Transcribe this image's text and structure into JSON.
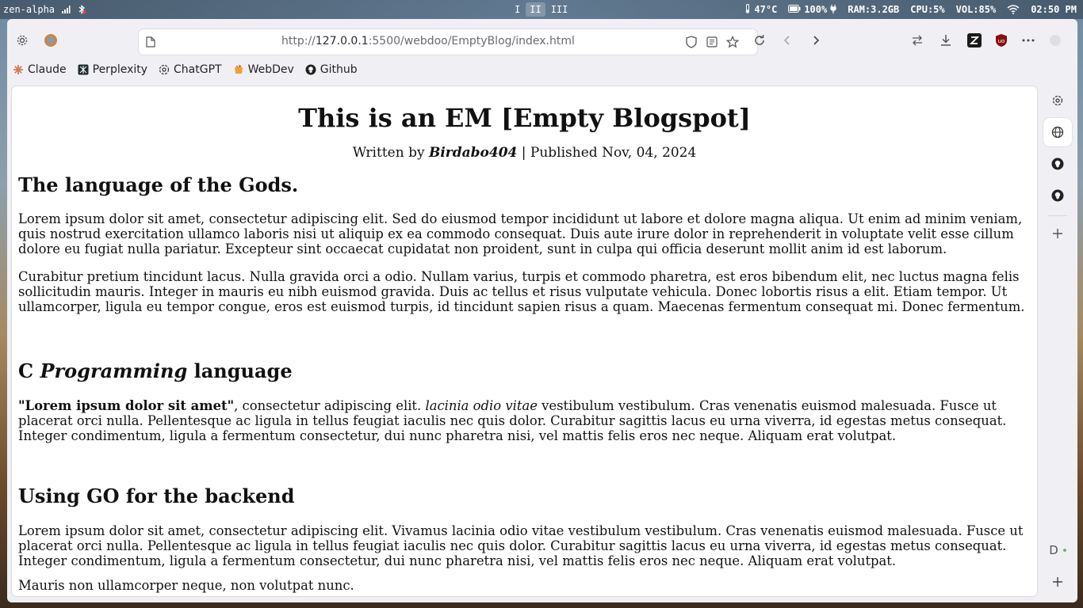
{
  "system_bar": {
    "hostname": "zen-alpha",
    "workspaces": [
      "I",
      "II",
      "III"
    ],
    "temperature": "47°C",
    "battery": "100%",
    "ram": "RAM:3.2GB",
    "cpu": "CPU:5%",
    "volume": "VOL:85%",
    "time": "02:50 PM"
  },
  "browser": {
    "url_prefix": "http://",
    "url_host": "127.0.0.1",
    "url_rest": ":5500/webdoo/EmptyBlog/index.html",
    "bookmarks": [
      {
        "label": "Claude",
        "icon": "claude-icon"
      },
      {
        "label": "Perplexity",
        "icon": "perplexity-icon"
      },
      {
        "label": "ChatGPT",
        "icon": "chatgpt-icon"
      },
      {
        "label": "WebDev",
        "icon": "webdev-icon"
      },
      {
        "label": "Github",
        "icon": "github-icon"
      }
    ],
    "sidebar_letter": "D"
  },
  "article": {
    "title": "This is an EM [Empty Blogspot]",
    "byline_prefix": "Written by ",
    "author": "Birdabo404",
    "byline_suffix": " | Published Nov, 04, 2024",
    "sections": [
      {
        "heading": "The language of the Gods.",
        "paragraphs": [
          "Lorem ipsum dolor sit amet, consectetur adipiscing elit. Sed do eiusmod tempor incididunt ut labore et dolore magna aliqua. Ut enim ad minim veniam, quis nostrud exercitation ullamco laboris nisi ut aliquip ex ea commodo consequat. Duis aute irure dolor in reprehenderit in voluptate velit esse cillum dolore eu fugiat nulla pariatur. Excepteur sint occaecat cupidatat non proident, sunt in culpa qui officia deserunt mollit anim id est laborum.",
          "Curabitur pretium tincidunt lacus. Nulla gravida orci a odio. Nullam varius, turpis et commodo pharetra, est eros bibendum elit, nec luctus magna felis sollicitudin mauris. Integer in mauris eu nibh euismod gravida. Duis ac tellus et risus vulputate vehicula. Donec lobortis risus a elit. Etiam tempor. Ut ullamcorper, ligula eu tempor congue, eros est euismod turpis, id tincidunt sapien risus a quam. Maecenas fermentum consequat mi. Donec fermentum."
        ]
      },
      {
        "heading_pre": "C ",
        "heading_em": "Programming",
        "heading_post": " language",
        "quote": "\"Lorem ipsum dolor sit amet\"",
        "text_a": ", consectetur adipiscing elit. ",
        "em_text": "lacinia odio vitae",
        "text_b": " vestibulum vestibulum. Cras venenatis euismod malesuada. Fusce ut placerat orci nulla. Pellentesque ac ligula in tellus feugiat iaculis nec quis dolor. Curabitur sagittis lacus eu urna viverra, id egestas metus consequat. Integer condimentum, ligula a fermentum consectetur, dui nunc pharetra nisi, vel mattis felis eros nec neque. Aliquam erat volutpat."
      },
      {
        "heading": "Using GO for the backend",
        "paragraph": "Lorem ipsum dolor sit amet, consectetur adipiscing elit. Vivamus lacinia odio vitae vestibulum vestibulum. Cras venenatis euismod malesuada. Fusce ut placerat orci nulla. Pellentesque ac ligula in tellus feugiat iaculis nec quis dolor. Curabitur sagittis lacus eu urna viverra, id egestas metus consequat. Integer condimentum, ligula a fermentum consectetur, dui nunc pharetra nisi, vel mattis felis eros nec neque. Aliquam erat volutpat.",
        "cut_paragraph": "Mauris non ullamcorper neque, non volutpat nunc."
      }
    ]
  }
}
